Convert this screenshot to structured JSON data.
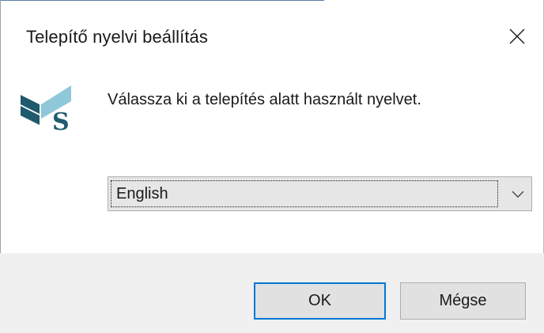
{
  "dialog": {
    "title": "Telepítő nyelvi beállítás",
    "message": "Válassza ki a telepítés alatt használt nyelvet."
  },
  "language_select": {
    "selected": "English"
  },
  "buttons": {
    "ok_label": "OK",
    "cancel_label": "Mégse"
  },
  "icons": {
    "close": "close-icon",
    "dropdown": "chevron-down-icon",
    "logo": "app-logo"
  },
  "colors": {
    "accent": "#0078d7",
    "logo_dark": "#1f5a6e",
    "logo_light": "#8fc8d8",
    "footer_bg": "#f0f0f0",
    "select_bg": "#e6e6e6"
  }
}
